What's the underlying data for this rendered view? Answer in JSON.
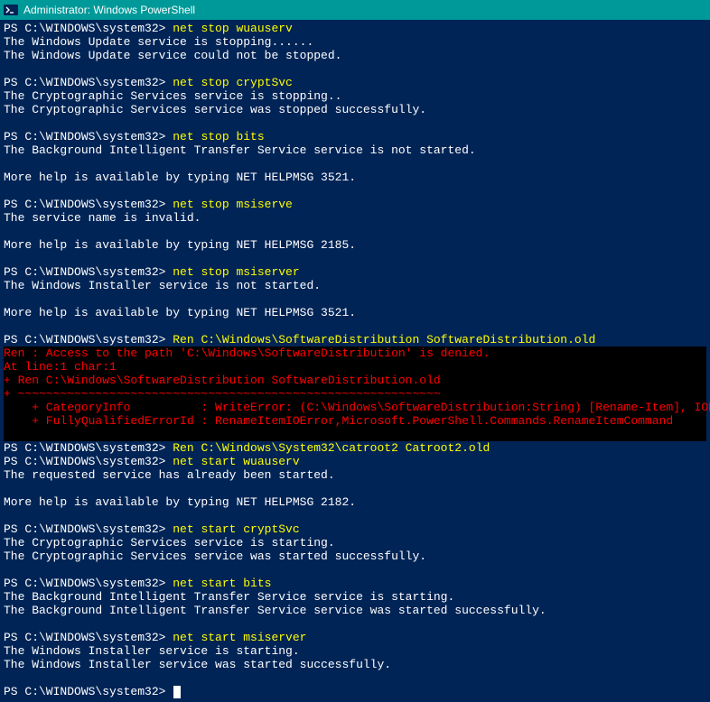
{
  "window": {
    "title": "Administrator: Windows PowerShell"
  },
  "prompt": "PS C:\\WINDOWS\\system32> ",
  "lines": [
    {
      "type": "cmd",
      "prompt": "PS C:\\WINDOWS\\system32> ",
      "command": "net stop wuauserv"
    },
    {
      "type": "out",
      "text": "The Windows Update service is stopping......"
    },
    {
      "type": "out",
      "text": "The Windows Update service could not be stopped."
    },
    {
      "type": "blank"
    },
    {
      "type": "cmd",
      "prompt": "PS C:\\WINDOWS\\system32> ",
      "command": "net stop cryptSvc"
    },
    {
      "type": "out",
      "text": "The Cryptographic Services service is stopping.."
    },
    {
      "type": "out",
      "text": "The Cryptographic Services service was stopped successfully."
    },
    {
      "type": "blank"
    },
    {
      "type": "cmd",
      "prompt": "PS C:\\WINDOWS\\system32> ",
      "command": "net stop bits"
    },
    {
      "type": "out",
      "text": "The Background Intelligent Transfer Service service is not started."
    },
    {
      "type": "blank"
    },
    {
      "type": "out",
      "text": "More help is available by typing NET HELPMSG 3521."
    },
    {
      "type": "blank"
    },
    {
      "type": "cmd",
      "prompt": "PS C:\\WINDOWS\\system32> ",
      "command": "net stop msiserve"
    },
    {
      "type": "out",
      "text": "The service name is invalid."
    },
    {
      "type": "blank"
    },
    {
      "type": "out",
      "text": "More help is available by typing NET HELPMSG 2185."
    },
    {
      "type": "blank"
    },
    {
      "type": "cmd",
      "prompt": "PS C:\\WINDOWS\\system32> ",
      "command": "net stop msiserver"
    },
    {
      "type": "out",
      "text": "The Windows Installer service is not started."
    },
    {
      "type": "blank"
    },
    {
      "type": "out",
      "text": "More help is available by typing NET HELPMSG 3521."
    },
    {
      "type": "blank"
    },
    {
      "type": "cmd",
      "prompt": "PS C:\\WINDOWS\\system32> ",
      "command": "Ren C:\\Windows\\SoftwareDistribution SoftwareDistribution.old"
    },
    {
      "type": "err",
      "text": "Ren : Access to the path 'C:\\Windows\\SoftwareDistribution' is denied."
    },
    {
      "type": "err",
      "text": "At line:1 char:1"
    },
    {
      "type": "err",
      "text": "+ Ren C:\\Windows\\SoftwareDistribution SoftwareDistribution.old"
    },
    {
      "type": "err",
      "text": "+ ~~~~~~~~~~~~~~~~~~~~~~~~~~~~~~~~~~~~~~~~~~~~~~~~~~~~~~~~~~~~"
    },
    {
      "type": "err",
      "text": "    + CategoryInfo          : WriteError: (C:\\Windows\\SoftwareDistribution:String) [Rename-Item], IOException"
    },
    {
      "type": "err",
      "text": "    + FullyQualifiedErrorId : RenameItemIOError,Microsoft.PowerShell.Commands.RenameItemCommand"
    },
    {
      "type": "err",
      "text": ""
    },
    {
      "type": "cmd",
      "prompt": "PS C:\\WINDOWS\\system32> ",
      "command": "Ren C:\\Windows\\System32\\catroot2 Catroot2.old"
    },
    {
      "type": "cmd",
      "prompt": "PS C:\\WINDOWS\\system32> ",
      "command": "net start wuauserv"
    },
    {
      "type": "out",
      "text": "The requested service has already been started."
    },
    {
      "type": "blank"
    },
    {
      "type": "out",
      "text": "More help is available by typing NET HELPMSG 2182."
    },
    {
      "type": "blank"
    },
    {
      "type": "cmd",
      "prompt": "PS C:\\WINDOWS\\system32> ",
      "command": "net start cryptSvc"
    },
    {
      "type": "out",
      "text": "The Cryptographic Services service is starting."
    },
    {
      "type": "out",
      "text": "The Cryptographic Services service was started successfully."
    },
    {
      "type": "blank"
    },
    {
      "type": "cmd",
      "prompt": "PS C:\\WINDOWS\\system32> ",
      "command": "net start bits"
    },
    {
      "type": "out",
      "text": "The Background Intelligent Transfer Service service is starting."
    },
    {
      "type": "out",
      "text": "The Background Intelligent Transfer Service service was started successfully."
    },
    {
      "type": "blank"
    },
    {
      "type": "cmd",
      "prompt": "PS C:\\WINDOWS\\system32> ",
      "command": "net start msiserver"
    },
    {
      "type": "out",
      "text": "The Windows Installer service is starting."
    },
    {
      "type": "out",
      "text": "The Windows Installer service was started successfully."
    },
    {
      "type": "blank"
    },
    {
      "type": "cursor",
      "prompt": "PS C:\\WINDOWS\\system32> "
    }
  ]
}
